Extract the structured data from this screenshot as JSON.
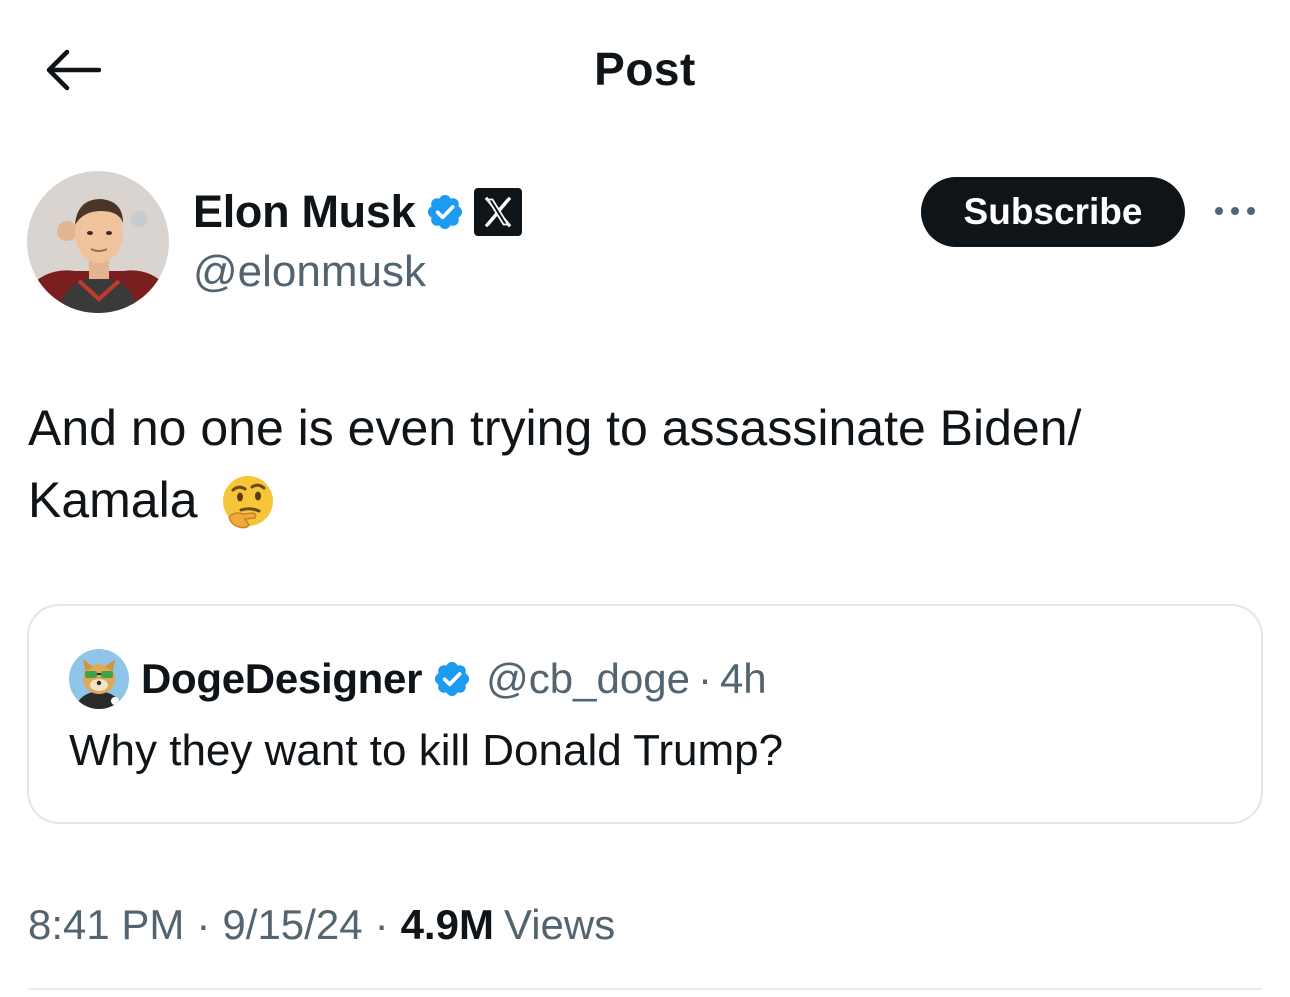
{
  "header": {
    "title": "Post"
  },
  "author": {
    "name": "Elon Musk",
    "handle": "@elonmusk",
    "subscribe_label": "Subscribe"
  },
  "tweet": {
    "line1": "And no one is even trying to assassinate Biden/",
    "line2": "Kamala",
    "emoji": "thinking-face"
  },
  "quote": {
    "name": "DogeDesigner",
    "handle": "@cb_doge",
    "separator": "·",
    "time": "4h",
    "text": "Why they want to kill Donald Trump?"
  },
  "meta": {
    "time": "8:41 PM",
    "separator": "·",
    "date": "9/15/24",
    "views_count": "4.9M",
    "views_label": "Views"
  },
  "colors": {
    "text_primary": "#0f1419",
    "text_secondary": "#536471",
    "verified_blue": "#1d9bf0",
    "card_border": "#e1e6ea"
  }
}
